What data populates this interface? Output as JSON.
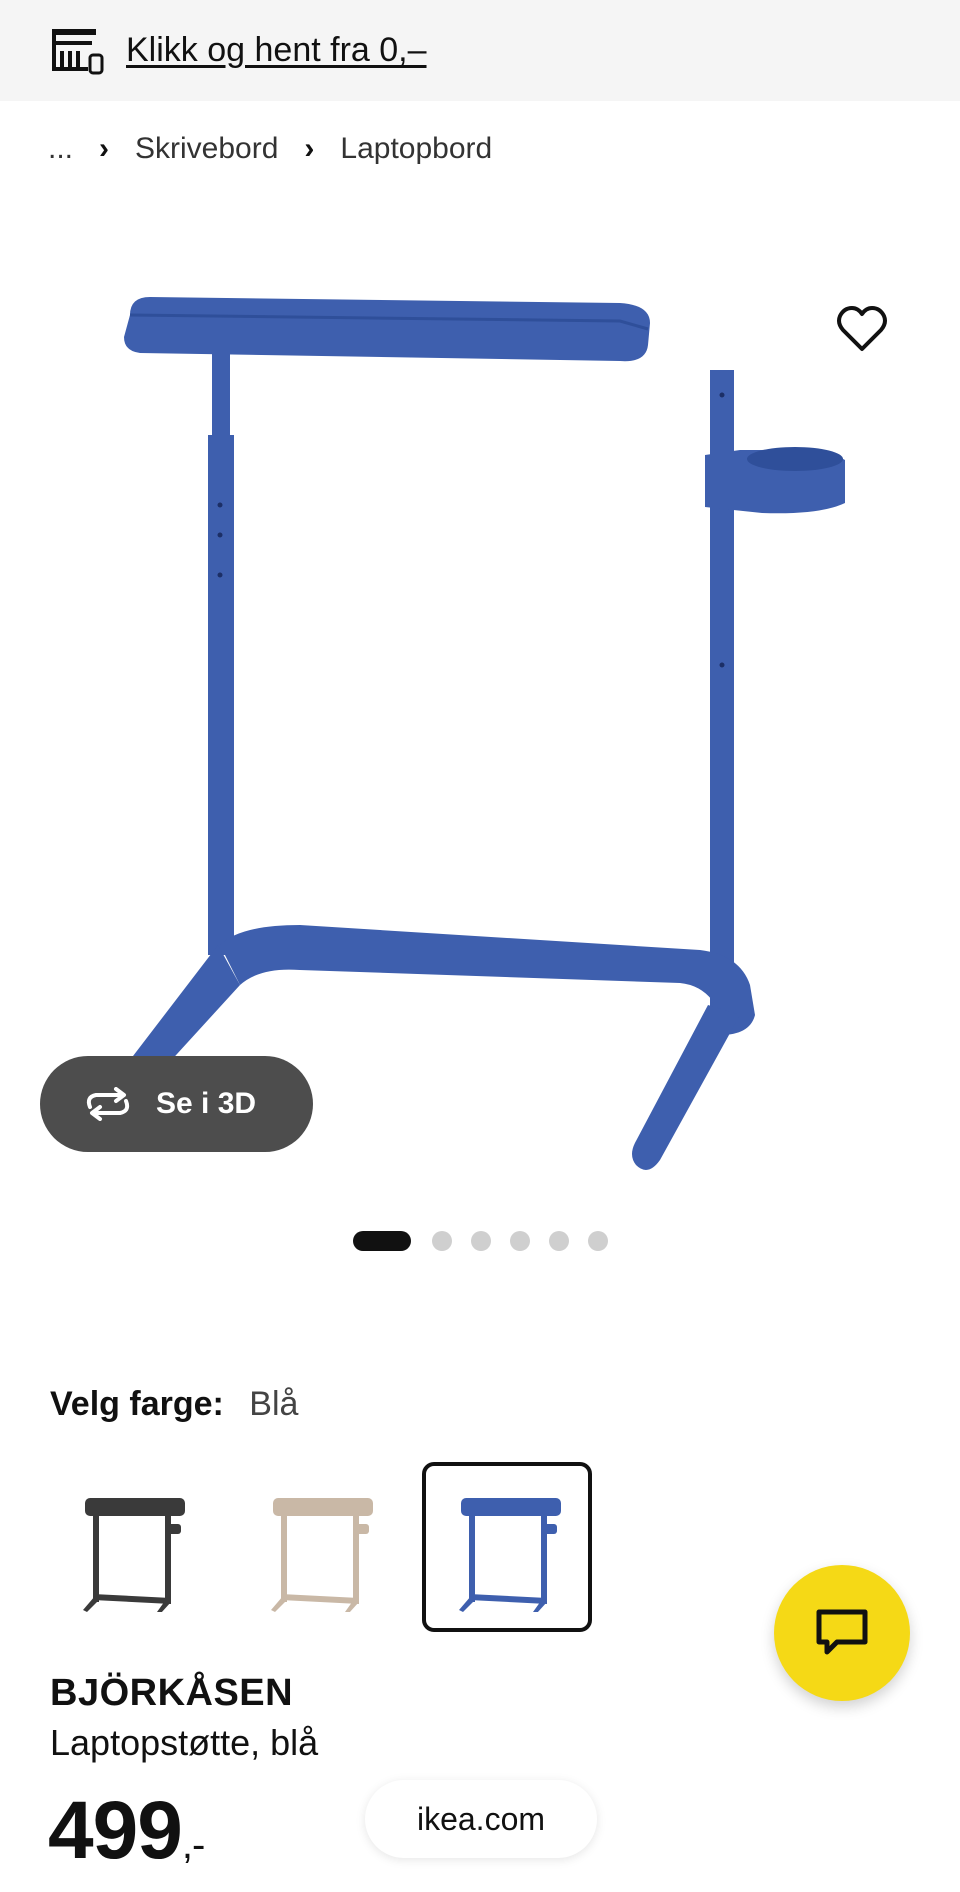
{
  "promo": {
    "link_text": "Klikk og hent fra 0,–",
    "icon": "store-pickup-icon"
  },
  "breadcrumb": {
    "ellipsis": "...",
    "items": [
      "Skrivebord",
      "Laptopbord"
    ],
    "separator": "›"
  },
  "gallery": {
    "view3d_label": "Se i 3D",
    "image_count": 6,
    "active_index": 0,
    "icons": {
      "favorite": "heart-icon",
      "rotate": "rotate-3d-icon"
    }
  },
  "color": {
    "label": "Velg farge:",
    "selected": "Blå",
    "options": [
      {
        "name": "black",
        "hex": "#3a3a3a"
      },
      {
        "name": "beige",
        "hex": "#c9b8a6"
      },
      {
        "name": "blue",
        "hex": "#3e5fae"
      }
    ],
    "selected_index": 2
  },
  "product": {
    "name": "BJÖRKÅSEN",
    "description": "Laptopstøtte, blå",
    "price": "499",
    "price_suffix": ",-"
  },
  "browser": {
    "url": "ikea.com"
  },
  "colors": {
    "accent_yellow": "#f5d916",
    "product_blue": "#3e5fae",
    "pill_gray": "#4d4d4d"
  }
}
